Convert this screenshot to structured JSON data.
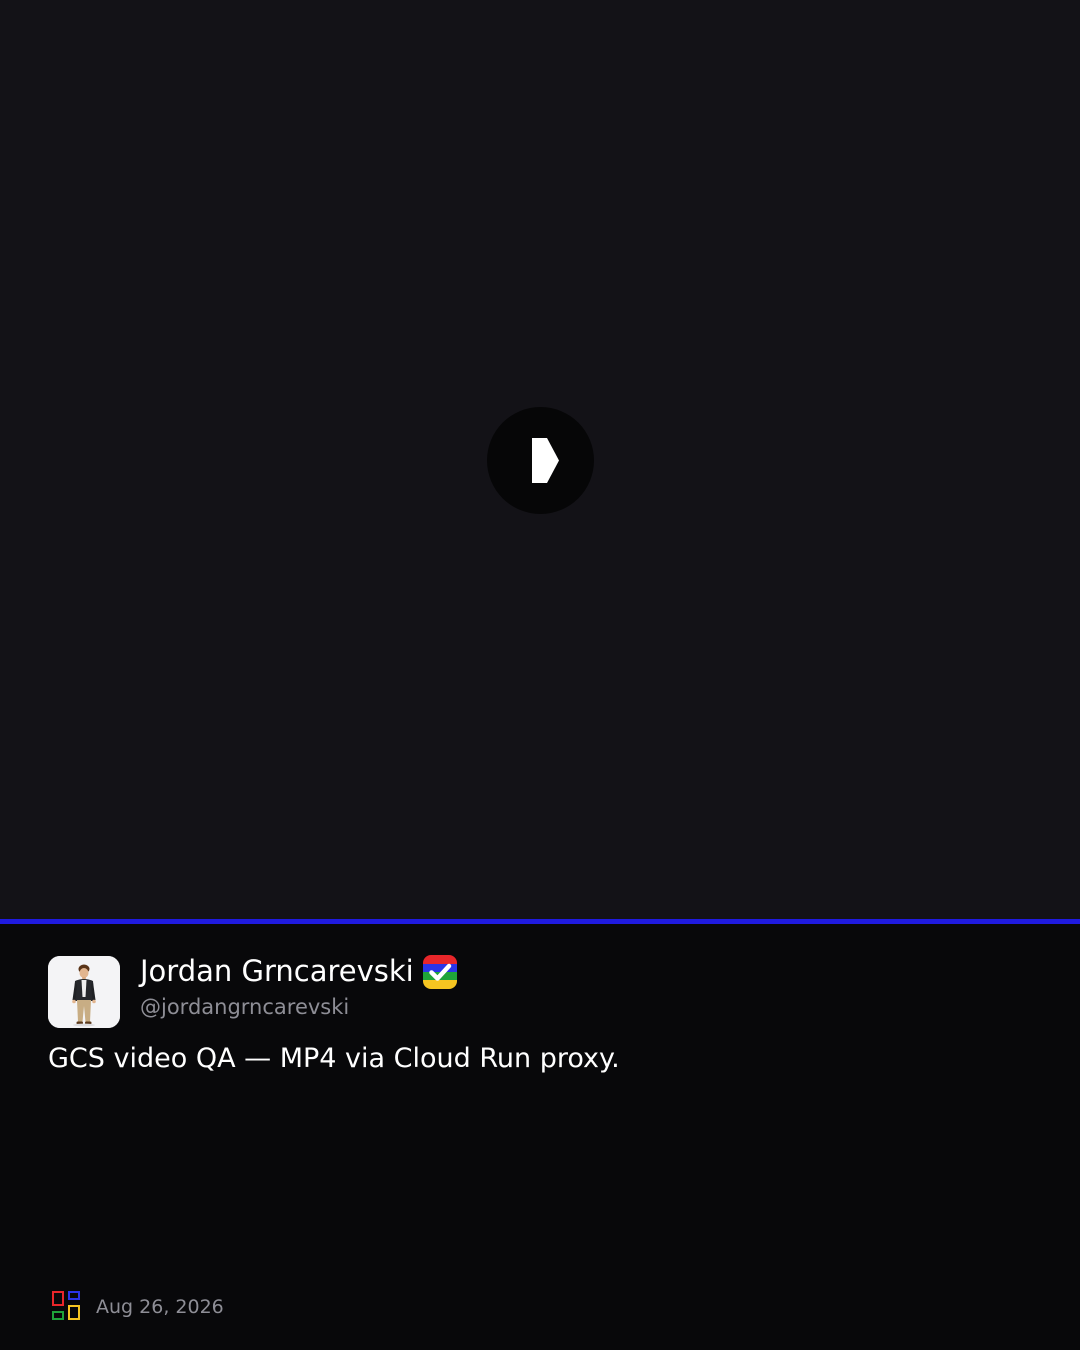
{
  "video": {
    "play_icon": "play-icon",
    "progress": 1.0
  },
  "author": {
    "name": "Jordan Grncarevski",
    "handle": "@jordangrncarevski",
    "avatar_icon": "user-avatar",
    "verified_icon": "verified-badge-icon"
  },
  "post": {
    "text": "GCS video QA — MP4 via Cloud Run proxy.",
    "date": "Aug 26, 2026"
  },
  "footer": {
    "logo_icon": "app-logo-icon"
  },
  "colors": {
    "background": "#08080a",
    "video_background": "#131217",
    "accent": "#1f1ae0",
    "text_primary": "#ffffff",
    "text_secondary": "#8e8e96"
  }
}
